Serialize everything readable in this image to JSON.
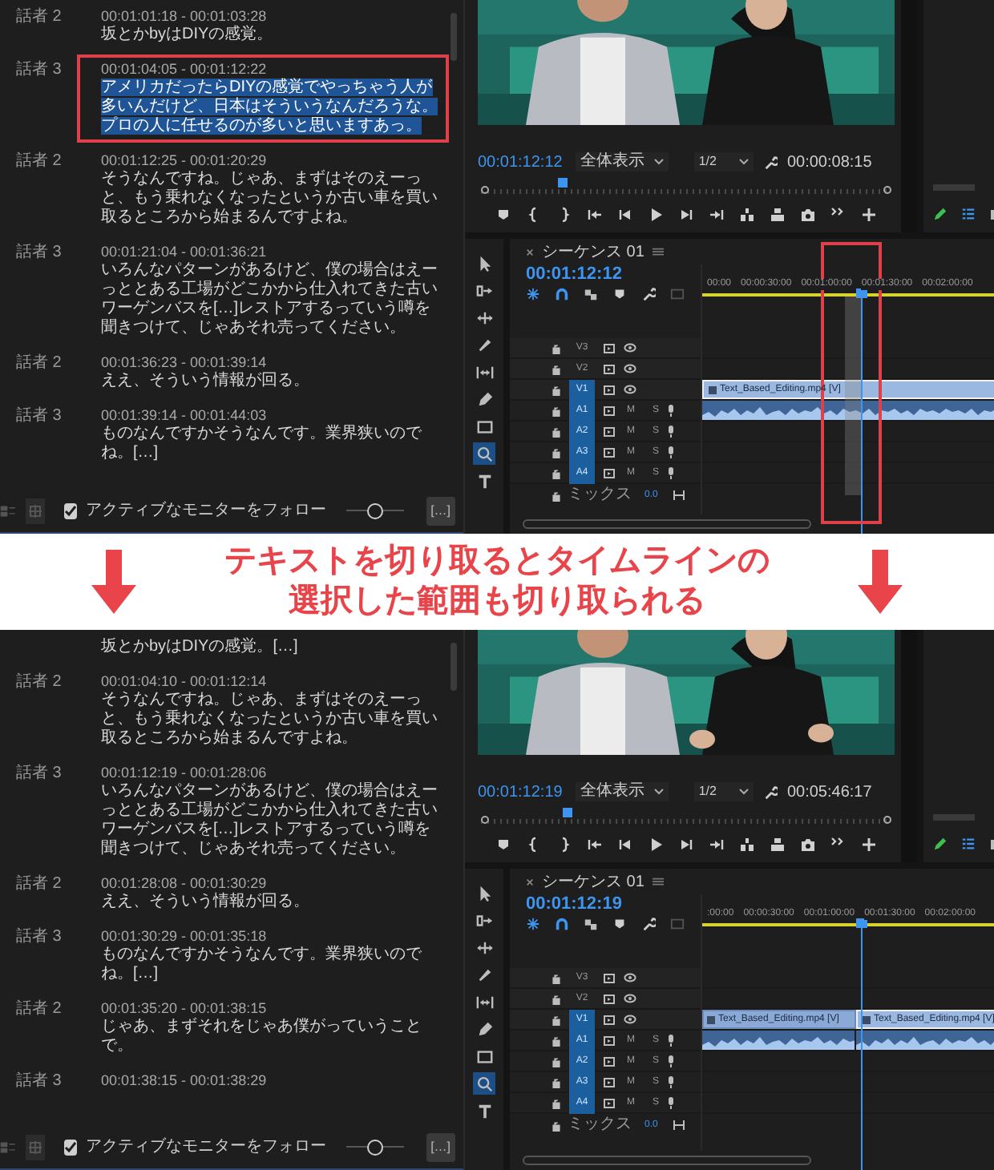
{
  "before": {
    "transcript": {
      "entries": [
        {
          "speaker": "話者 2",
          "timecode": "00:01:01:18 - 00:01:03:28",
          "text": "坂とかbyはDIYの感覚。",
          "selected": false
        },
        {
          "speaker": "話者 3",
          "timecode": "00:01:04:05 - 00:01:12:22",
          "text": "アメリカだったらDIYの感覚でやっちゃう人が多いんだけど、日本はそういうなんだろうな。プロの人に任せるのが多いと思いますあっ。",
          "selected": true
        },
        {
          "speaker": "話者 2",
          "timecode": "00:01:12:25 - 00:01:20:29",
          "text": "そうなんですね。じゃあ、まずはそのえーっと、もう乗れなくなったというか古い車を買い取るところから始まるんですよね。",
          "selected": false
        },
        {
          "speaker": "話者 3",
          "timecode": "00:01:21:04 - 00:01:36:21",
          "text": "いろんなパターンがあるけど、僕の場合はえーっととある工場がどこかから仕入れてきた古いワーゲンバスを[…]レストアするっていう噂を聞きつけて、じゃあそれ売ってください。",
          "selected": false
        },
        {
          "speaker": "話者 2",
          "timecode": "00:01:36:23 - 00:01:39:14",
          "text": "ええ、そういう情報が回る。",
          "selected": false
        },
        {
          "speaker": "話者 3",
          "timecode": "00:01:39:14 - 00:01:44:03",
          "text": "ものなんですかそうなんです。業界狭いのでね。[…]",
          "selected": false
        }
      ],
      "follow_monitor": {
        "label": "アクティブなモニターをフォロー",
        "checked": true
      },
      "zoom_slider": {
        "level": 0.5
      },
      "more_button": "[…]"
    },
    "program_monitor": {
      "timecode": "00:01:12:12",
      "fit": "全体表示",
      "resolution": "1/2",
      "duration": "00:00:08:15",
      "scrubber": {
        "level": 0.2
      }
    },
    "timeline": {
      "sequence": "シーケンス 01",
      "timecode": "00:01:12:12",
      "ruler": [
        "00:00",
        "00:00:30:00",
        "00:01:00:00",
        "00:01:30:00",
        "00:02:00:00"
      ],
      "playhead": {
        "level": 0.53
      },
      "range_selected": true,
      "callout": true,
      "tools": [
        {
          "kind": "select",
          "selected": false
        },
        {
          "kind": "track_select",
          "selected": false
        },
        {
          "kind": "ripple",
          "selected": false
        },
        {
          "kind": "razor",
          "selected": false
        },
        {
          "kind": "slip",
          "selected": false
        },
        {
          "kind": "pen",
          "selected": false
        },
        {
          "kind": "rectangle",
          "selected": false
        },
        {
          "kind": "zoom",
          "selected": true
        },
        {
          "kind": "type",
          "selected": false
        }
      ],
      "tracks": [
        {
          "name": "V3",
          "kind": "video",
          "targeted": false
        },
        {
          "name": "V2",
          "kind": "video",
          "targeted": false
        },
        {
          "name": "V1",
          "kind": "video",
          "targeted": true
        },
        {
          "name": "A1",
          "kind": "audio",
          "targeted": true,
          "mute": "M",
          "solo": "S"
        },
        {
          "name": "A2",
          "kind": "audio",
          "targeted": true,
          "mute": "M",
          "solo": "S"
        },
        {
          "name": "A3",
          "kind": "audio",
          "targeted": true,
          "mute": "M",
          "solo": "S"
        },
        {
          "name": "A4",
          "kind": "audio",
          "targeted": true,
          "mute": "M",
          "solo": "S"
        }
      ],
      "mix": {
        "label": "ミックス",
        "value": "0.0"
      },
      "clips": [
        {
          "label": "Text_Based_Editing.mp4 [V]",
          "selected": true
        }
      ]
    }
  },
  "banner": {
    "lines": [
      "テキストを切り取るとタイムラインの",
      "選択した範囲も切り取られる"
    ]
  },
  "after": {
    "transcript": {
      "entries": [
        {
          "text": "坂とかbyはDIYの感覚。[…]",
          "selected": false
        },
        {
          "speaker": "話者 2",
          "timecode": "00:01:04:10 - 00:01:12:14",
          "text": "そうなんですね。じゃあ、まずはそのえーっと、もう乗れなくなったというか古い車を買い取るところから始まるんですよね。",
          "selected": false
        },
        {
          "speaker": "話者 3",
          "timecode": "00:01:12:19 - 00:01:28:06",
          "text": "いろんなパターンがあるけど、僕の場合はえーっととある工場がどこかから仕入れてきた古いワーゲンバスを[…]レストアするっていう噂を聞きつけて、じゃあそれ売ってください。",
          "selected": false
        },
        {
          "speaker": "話者 2",
          "timecode": "00:01:28:08 - 00:01:30:29",
          "text": "ええ、そういう情報が回る。",
          "selected": false
        },
        {
          "speaker": "話者 3",
          "timecode": "00:01:30:29 - 00:01:35:18",
          "text": "ものなんですかそうなんです。業界狭いのでね。[…]",
          "selected": false
        },
        {
          "speaker": "話者 2",
          "timecode": "00:01:35:20 - 00:01:38:15",
          "text": "じゃあ、まずそれをじゃあ僕がっていうことで。",
          "selected": false
        },
        {
          "speaker": "話者 3",
          "timecode": "00:01:38:15 - 00:01:38:29",
          "selected": false
        }
      ],
      "follow_monitor": {
        "label": "アクティブなモニターをフォロー",
        "checked": true
      },
      "zoom_slider": {
        "level": 0.5
      },
      "more_button": "[…]"
    },
    "program_monitor": {
      "timecode": "00:01:12:19",
      "fit": "全体表示",
      "resolution": "1/2",
      "duration": "00:05:46:17",
      "scrubber": {
        "level": 0.21
      }
    },
    "timeline": {
      "sequence": "シーケンス 01",
      "timecode": "00:01:12:19",
      "ruler": [
        ":00:00",
        "00:00:30:00",
        "00:01:00:00",
        "00:01:30:00",
        "00:02:00:00"
      ],
      "playhead": {
        "level": 0.53
      },
      "range_selected": false,
      "callout": false,
      "tools": [
        {
          "kind": "select",
          "selected": false
        },
        {
          "kind": "track_select",
          "selected": false
        },
        {
          "kind": "ripple",
          "selected": false
        },
        {
          "kind": "razor",
          "selected": false
        },
        {
          "kind": "slip",
          "selected": false
        },
        {
          "kind": "pen",
          "selected": false
        },
        {
          "kind": "rectangle",
          "selected": false
        },
        {
          "kind": "zoom",
          "selected": true
        },
        {
          "kind": "type",
          "selected": false
        }
      ],
      "tracks": [
        {
          "name": "V3",
          "kind": "video",
          "targeted": false
        },
        {
          "name": "V2",
          "kind": "video",
          "targeted": false
        },
        {
          "name": "V1",
          "kind": "video",
          "targeted": true
        },
        {
          "name": "A1",
          "kind": "audio",
          "targeted": true,
          "mute": "M",
          "solo": "S"
        },
        {
          "name": "A2",
          "kind": "audio",
          "targeted": true,
          "mute": "M",
          "solo": "S"
        },
        {
          "name": "A3",
          "kind": "audio",
          "targeted": true,
          "mute": "M",
          "solo": "S"
        },
        {
          "name": "A4",
          "kind": "audio",
          "targeted": true,
          "mute": "M",
          "solo": "S"
        }
      ],
      "mix": {
        "label": "ミックス",
        "value": "0.0"
      },
      "clips": [
        {
          "label": "Text_Based_Editing.mp4 [V]",
          "selected": false
        },
        {
          "label": "Text_Based_Editing.mp4 [V]",
          "selected": true
        }
      ]
    }
  }
}
